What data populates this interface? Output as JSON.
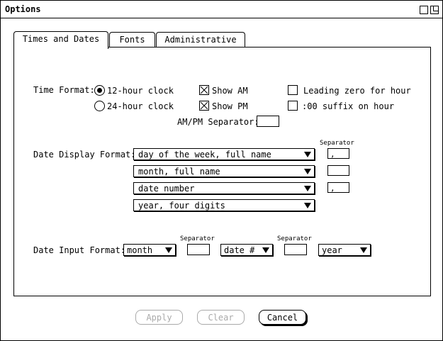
{
  "window": {
    "title": "Options"
  },
  "tabs": [
    {
      "label": "Times and Dates"
    },
    {
      "label": "Fonts"
    },
    {
      "label": "Administrative"
    }
  ],
  "time": {
    "label": "Time Format:",
    "radio_12": "12-hour clock",
    "radio_24": "24-hour clock",
    "show_am": "Show AM",
    "show_pm": "Show PM",
    "leading_zero": "Leading zero for hour",
    "suffix_00": ":00 suffix on hour",
    "ampm_sep_label": "AM/PM Separator:",
    "ampm_sep_value": ""
  },
  "display": {
    "label": "Date Display Format:",
    "separator_label": "Separator",
    "rows": [
      {
        "value": "day of the week, full name",
        "sep": ","
      },
      {
        "value": "month, full name",
        "sep": ""
      },
      {
        "value": "date number",
        "sep": ","
      },
      {
        "value": "year, four digits"
      }
    ]
  },
  "input": {
    "label": "Date Input Format:",
    "sep_label": "Separator",
    "sel1": "month",
    "sel2": "date #",
    "sel3": "year",
    "sep1": "",
    "sep2": ""
  },
  "buttons": {
    "apply": "Apply",
    "clear": "Clear",
    "cancel": "Cancel"
  }
}
